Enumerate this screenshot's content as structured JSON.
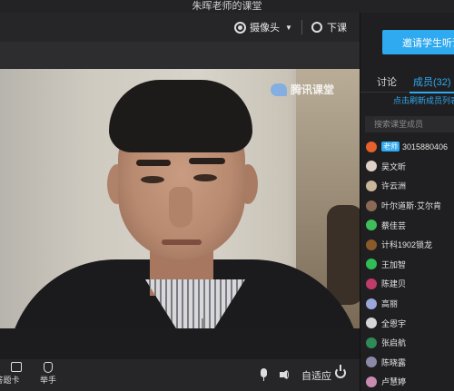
{
  "window": {
    "title": "朱晖老师的课堂"
  },
  "toolbar": {
    "camera_label": "摄像头",
    "end_class_label": "下课"
  },
  "video": {
    "logo_text": "腾讯课堂"
  },
  "bottom": {
    "answer_card_label": "答题卡",
    "raise_hand_label": "举手",
    "adapt_label": "自适应"
  },
  "sidebar": {
    "invite_label": "邀请学生听课",
    "tab_discuss": "讨论",
    "tab_members": "成员(32)",
    "refresh_hint": "点击刷新成员列表",
    "search_placeholder": "搜索课堂成员",
    "teacher_badge": "老师",
    "members": [
      {
        "name": "3015880406",
        "color": "#e8602c"
      },
      {
        "name": "吴文昕",
        "color": "#e0d2c8"
      },
      {
        "name": "许云洲",
        "color": "#c9b79a"
      },
      {
        "name": "叶尔道斯·艾尔肯",
        "color": "#8b6a55"
      },
      {
        "name": "蔡佳芸",
        "color": "#3fbf5a"
      },
      {
        "name": "计科1902锁龙",
        "color": "#8a5a2a"
      },
      {
        "name": "王加智",
        "color": "#2fbf55"
      },
      {
        "name": "陈建贝",
        "color": "#c03a6a"
      },
      {
        "name": "高丽",
        "color": "#9aa7d8"
      },
      {
        "name": "全恩宇",
        "color": "#d6d6d6"
      },
      {
        "name": "张启航",
        "color": "#2e8b57"
      },
      {
        "name": "陈晓露",
        "color": "#8a8aa8"
      },
      {
        "name": "卢慧婷",
        "color": "#c98ab0"
      }
    ]
  }
}
